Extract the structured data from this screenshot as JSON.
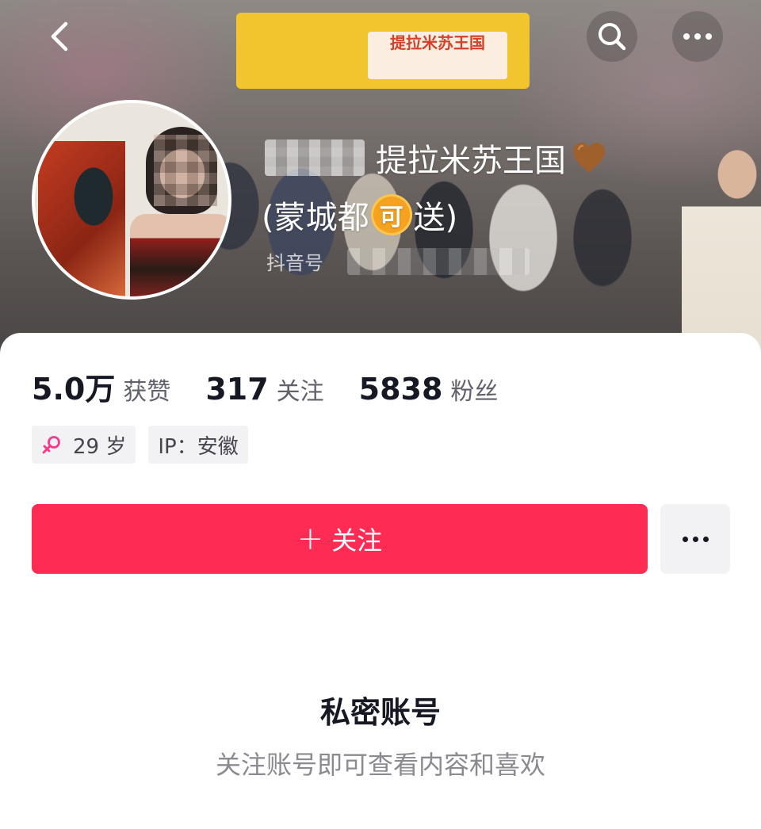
{
  "header": {
    "back_icon": "chevron-left-icon",
    "search_icon": "search-icon",
    "more_icon": "more-horizontal-icon",
    "cover_sign_text": "提拉米苏王国"
  },
  "profile": {
    "name_line1": "提拉米苏王国",
    "name_line2_prefix": "(蒙城都",
    "name_badge": "可",
    "name_line2_suffix": "送)",
    "heart_color": "#a0602c",
    "douyin_id_label": "抖音号",
    "stats": [
      {
        "value": "5.0万",
        "label": "获赞"
      },
      {
        "value": "317",
        "label": "关注"
      },
      {
        "value": "5838",
        "label": "粉丝"
      }
    ],
    "tags": {
      "age": "29 岁",
      "ip": "IP：安徽"
    },
    "gender_color": "#f5398b"
  },
  "actions": {
    "follow_plus": "+",
    "follow_label": "关注",
    "follow_color": "#fe2c55"
  },
  "private": {
    "title": "私密账号",
    "subtitle": "关注账号即可查看内容和喜欢"
  }
}
